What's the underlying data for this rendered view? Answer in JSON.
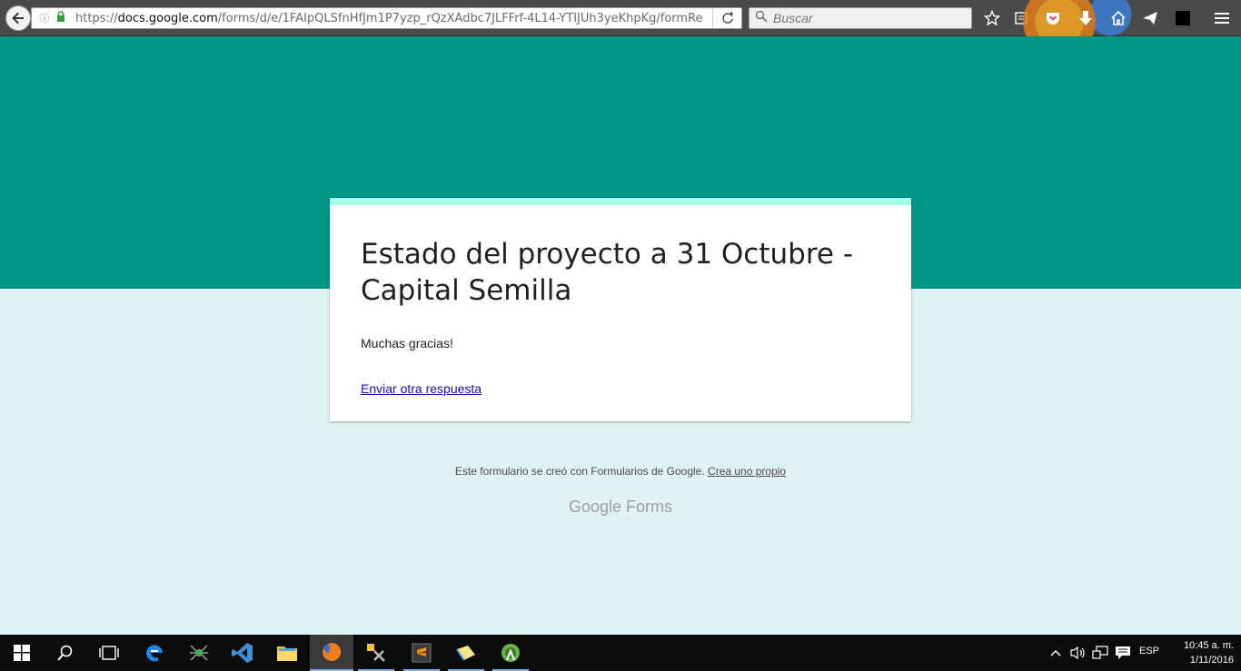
{
  "browser": {
    "url_prefix": "https://",
    "url_host": "docs.google.com",
    "url_path": "/forms/d/e/1FAIpQLSfnHfJm1P7yzp_rQzXAdbc7JLFFrf-4L14-YTIJUh3yeKhpKg/formRe",
    "search_placeholder": "Buscar"
  },
  "form": {
    "title": "Estado del proyecto a 31 Octubre - Capital Semilla",
    "message": "Muchas gracias!",
    "link_label": "Enviar otra respuesta"
  },
  "footer": {
    "text": "Este formulario se creó con Formularios de Google.",
    "link": "Crea uno propio",
    "logo": "Google Forms"
  },
  "taskbar": {
    "language": "ESP",
    "time": "10:45 a. m.",
    "date": "1/11/2016"
  },
  "colors": {
    "header": "#009688",
    "background": "#e0f2f1",
    "card_accent": "#a7ffeb"
  }
}
